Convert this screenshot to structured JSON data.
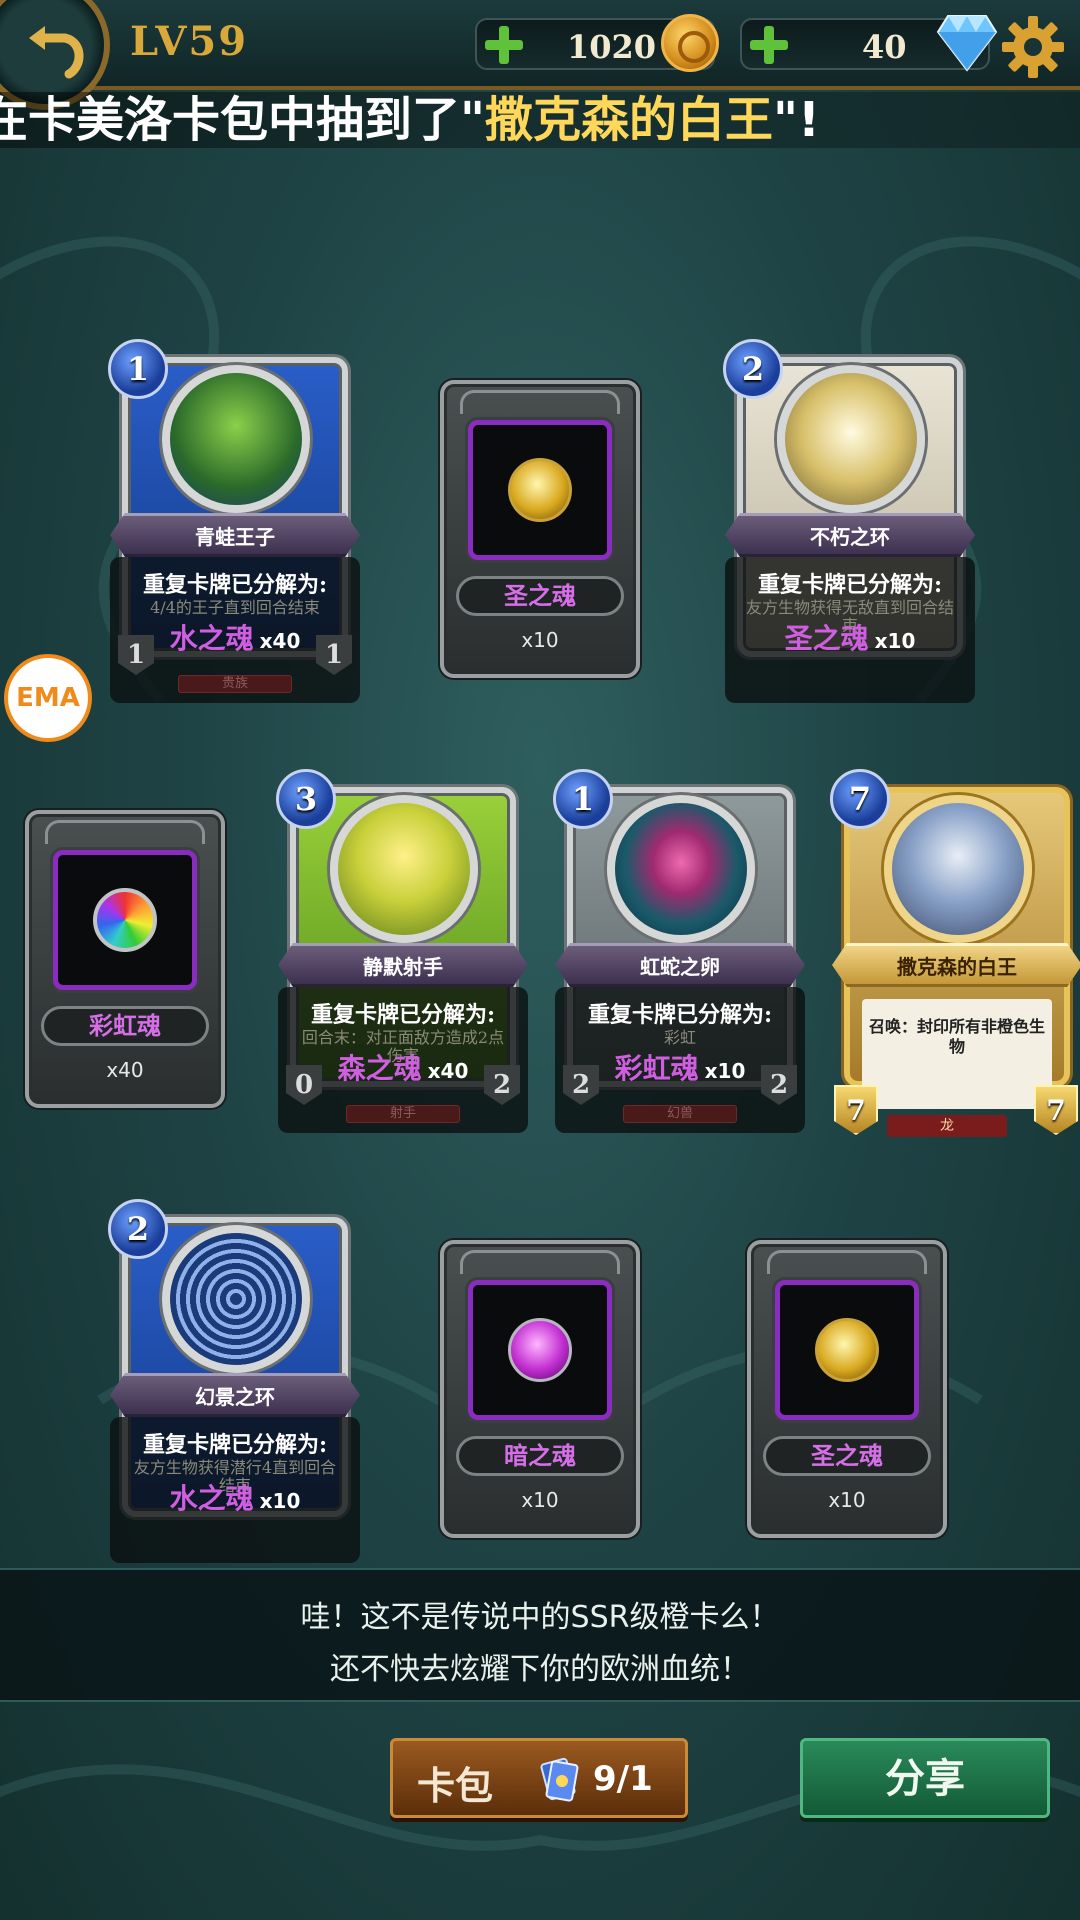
{
  "header": {
    "level": "LV59",
    "gold": "1020",
    "gems": "40"
  },
  "marquee": {
    "prefix": "在卡美洛卡包中抽到了\"",
    "highlight": "撒克森的白王",
    "suffix": "\"!"
  },
  "overlay_text": "重复卡牌已分解为:",
  "cards": [
    {
      "name": "青蛙王子",
      "mana": "1",
      "soul": "水之魂",
      "mult": "x40",
      "ghost": "4/4的王子直到回合结束",
      "atk": "1",
      "hp": "1",
      "race": "贵族"
    },
    {
      "name": "不朽之环",
      "mana": "2",
      "soul": "圣之魂",
      "mult": "x10",
      "ghost": "友方生物获得无敌直到回合结束"
    },
    {
      "name": "静默射手",
      "mana": "3",
      "soul": "森之魂",
      "mult": "x40",
      "ghost": "回合末：对正面敌方造成2点伤害",
      "atk": "0",
      "hp": "2",
      "race": "射手"
    },
    {
      "name": "虹蛇之卵",
      "mana": "1",
      "soul": "彩虹魂",
      "mult": "x10",
      "ghost": "彩虹",
      "atk": "2",
      "hp": "2",
      "race": "幻兽"
    },
    {
      "name": "幻景之环",
      "mana": "2",
      "soul": "水之魂",
      "mult": "x10",
      "ghost": "友方生物获得潜行4直到回合结束"
    }
  ],
  "gold_card": {
    "name": "撒克森的白王",
    "mana": "7",
    "desc": "召唤：封印所有非橙色生物",
    "atk": "7",
    "hp": "7",
    "race": "龙"
  },
  "souls": [
    {
      "name": "圣之魂",
      "count": "x10",
      "orb": "holy"
    },
    {
      "name": "彩虹魂",
      "count": "x40",
      "orb": "rainbow"
    },
    {
      "name": "暗之魂",
      "count": "x10",
      "orb": "dark"
    },
    {
      "name": "圣之魂",
      "count": "x10",
      "orb": "holy"
    }
  ],
  "message": {
    "line1": "哇！这不是传说中的SSR级橙卡么！",
    "line2": "还不快去炫耀下你的欧洲血统！"
  },
  "buttons": {
    "pack_label": "卡包",
    "pack_count": "9/1",
    "share_label": "分享"
  },
  "badge": "EMA",
  "colors": {
    "soul_text": "#cf5fe0",
    "highlight": "#ffd85a",
    "level": "#d9a83a"
  }
}
